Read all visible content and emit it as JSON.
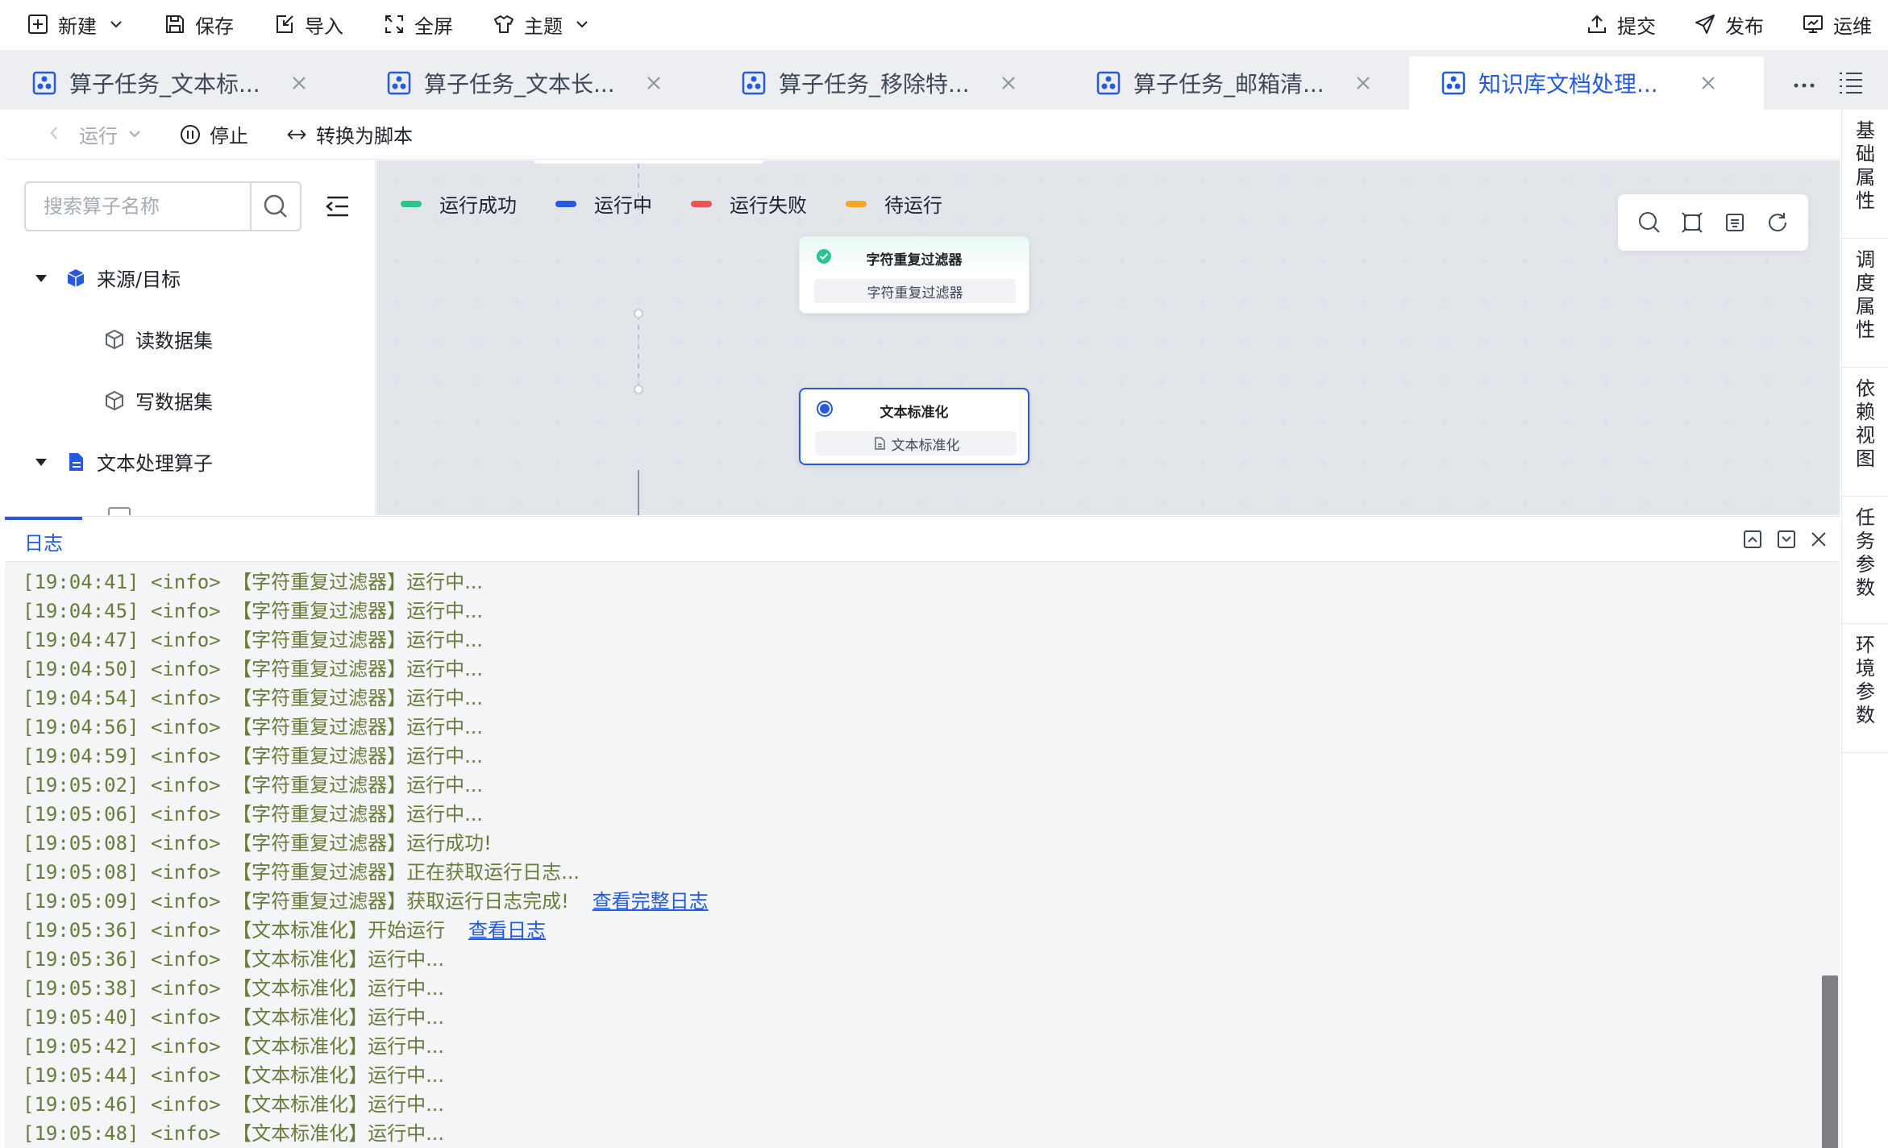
{
  "toolbar": {
    "new_label": "新建",
    "save_label": "保存",
    "import_label": "导入",
    "fullscreen_label": "全屏",
    "theme_label": "主题",
    "submit_label": "提交",
    "publish_label": "发布",
    "ops_label": "运维"
  },
  "tabs": [
    {
      "label": "算子任务_文本标..."
    },
    {
      "label": "算子任务_文本长..."
    },
    {
      "label": "算子任务_移除特..."
    },
    {
      "label": "算子任务_邮箱清..."
    },
    {
      "label": "知识库文档处理...",
      "active": true
    }
  ],
  "subtoolbar": {
    "run_label": "运行",
    "stop_label": "停止",
    "convert_label": "转换为脚本"
  },
  "leftpanel": {
    "search_placeholder": "搜索算子名称",
    "tree": [
      {
        "label": "来源/目标"
      },
      {
        "label": "读数据集"
      },
      {
        "label": "写数据集"
      },
      {
        "label": "文本处理算子"
      }
    ]
  },
  "legend": [
    {
      "label": "运行成功",
      "color": "#2bc48a"
    },
    {
      "label": "运行中",
      "color": "#2459e0"
    },
    {
      "label": "运行失败",
      "color": "#f05252"
    },
    {
      "label": "待运行",
      "color": "#f5a623"
    }
  ],
  "nodes": [
    {
      "title": "字符重复过滤器",
      "sub": "字符重复过滤器",
      "status": "success"
    },
    {
      "title": "文本标准化",
      "sub": "文本标准化",
      "status": "running"
    }
  ],
  "log": {
    "tab_label": "日志",
    "lines": [
      {
        "time": "[19:04:41]",
        "level": "<info>",
        "msg": "【字符重复过滤器】运行中..."
      },
      {
        "time": "[19:04:45]",
        "level": "<info>",
        "msg": "【字符重复过滤器】运行中..."
      },
      {
        "time": "[19:04:47]",
        "level": "<info>",
        "msg": "【字符重复过滤器】运行中..."
      },
      {
        "time": "[19:04:50]",
        "level": "<info>",
        "msg": "【字符重复过滤器】运行中..."
      },
      {
        "time": "[19:04:54]",
        "level": "<info>",
        "msg": "【字符重复过滤器】运行中..."
      },
      {
        "time": "[19:04:56]",
        "level": "<info>",
        "msg": "【字符重复过滤器】运行中..."
      },
      {
        "time": "[19:04:59]",
        "level": "<info>",
        "msg": "【字符重复过滤器】运行中..."
      },
      {
        "time": "[19:05:02]",
        "level": "<info>",
        "msg": "【字符重复过滤器】运行中..."
      },
      {
        "time": "[19:05:06]",
        "level": "<info>",
        "msg": "【字符重复过滤器】运行中..."
      },
      {
        "time": "[19:05:08]",
        "level": "<info>",
        "msg": "【字符重复过滤器】运行成功!"
      },
      {
        "time": "[19:05:08]",
        "level": "<info>",
        "msg": "【字符重复过滤器】正在获取运行日志..."
      },
      {
        "time": "[19:05:09]",
        "level": "<info>",
        "msg": "【字符重复过滤器】获取运行日志完成!",
        "link": "查看完整日志"
      },
      {
        "time": "[19:05:36]",
        "level": "<info>",
        "msg": "【文本标准化】开始运行",
        "link": "查看日志"
      },
      {
        "time": "[19:05:36]",
        "level": "<info>",
        "msg": "【文本标准化】运行中..."
      },
      {
        "time": "[19:05:38]",
        "level": "<info>",
        "msg": "【文本标准化】运行中..."
      },
      {
        "time": "[19:05:40]",
        "level": "<info>",
        "msg": "【文本标准化】运行中..."
      },
      {
        "time": "[19:05:42]",
        "level": "<info>",
        "msg": "【文本标准化】运行中..."
      },
      {
        "time": "[19:05:44]",
        "level": "<info>",
        "msg": "【文本标准化】运行中..."
      },
      {
        "time": "[19:05:46]",
        "level": "<info>",
        "msg": "【文本标准化】运行中..."
      },
      {
        "time": "[19:05:48]",
        "level": "<info>",
        "msg": "【文本标准化】运行中..."
      }
    ]
  },
  "sidetabs": [
    {
      "label": "基础属性"
    },
    {
      "label": "调度属性"
    },
    {
      "label": "依赖视图"
    },
    {
      "label": "任务参数"
    },
    {
      "label": "环境参数"
    }
  ],
  "colors": {
    "accent": "#2459e0",
    "success": "#2bc48a",
    "log_text": "#6b7a3a"
  }
}
